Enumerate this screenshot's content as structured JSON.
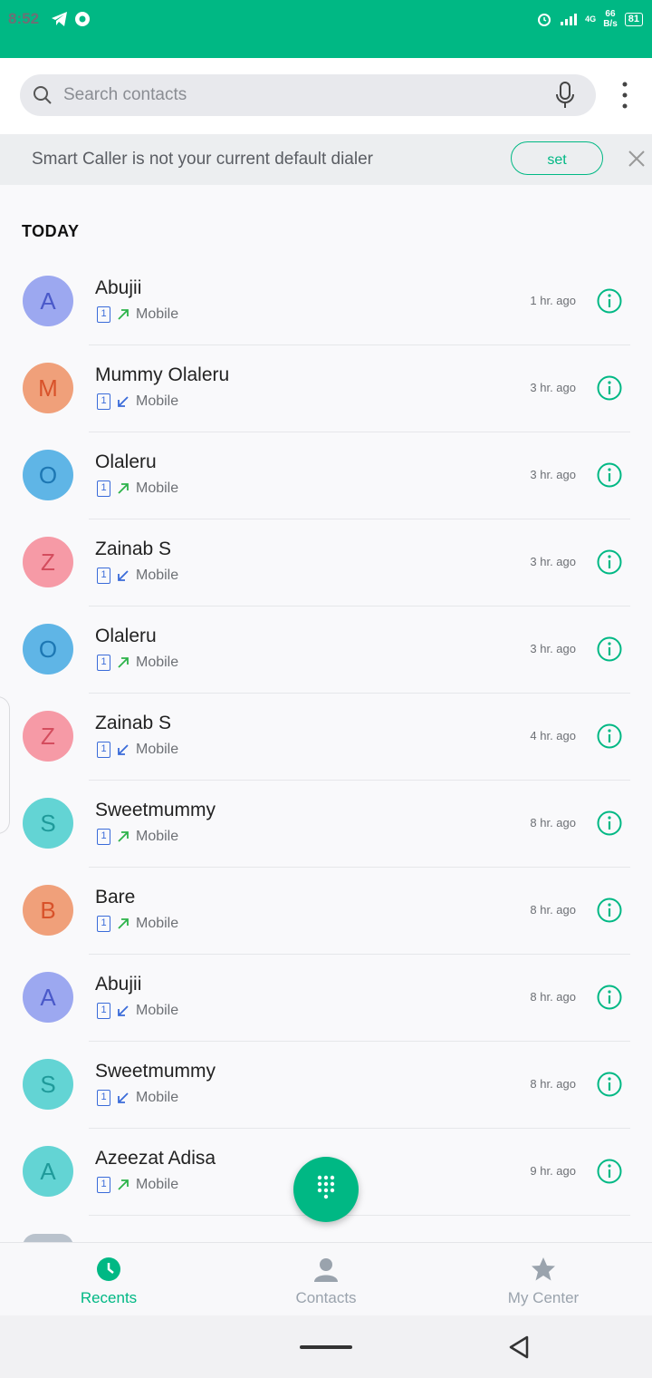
{
  "status": {
    "time": "8:52",
    "net_speed_top": "66",
    "net_speed_bottom": "B/s",
    "battery": "81",
    "network": "4G"
  },
  "search": {
    "placeholder": "Search contacts"
  },
  "banner": {
    "text": "Smart Caller is not your current default dialer",
    "button": "set"
  },
  "section": {
    "title": "TODAY"
  },
  "calls": [
    {
      "initial": "A",
      "name": "Abujii",
      "type": "outgoing",
      "label": "Mobile",
      "sim": "1",
      "time": "1 hr. ago",
      "bg": "#9ca8f0",
      "fg": "#4a59c9"
    },
    {
      "initial": "M",
      "name": "Mummy Olaleru",
      "type": "incoming",
      "label": "Mobile",
      "sim": "1",
      "time": "3 hr. ago",
      "bg": "#f0a07a",
      "fg": "#d8522a"
    },
    {
      "initial": "O",
      "name": "Olaleru",
      "type": "outgoing",
      "label": "Mobile",
      "sim": "1",
      "time": "3 hr. ago",
      "bg": "#5fb5e6",
      "fg": "#1d77b3"
    },
    {
      "initial": "Z",
      "name": "Zainab S",
      "type": "incoming",
      "label": "Mobile",
      "sim": "1",
      "time": "3 hr. ago",
      "bg": "#f69aa6",
      "fg": "#d44d5e"
    },
    {
      "initial": "O",
      "name": "Olaleru",
      "type": "outgoing",
      "label": "Mobile",
      "sim": "1",
      "time": "3 hr. ago",
      "bg": "#5fb5e6",
      "fg": "#1d77b3"
    },
    {
      "initial": "Z",
      "name": "Zainab S",
      "type": "incoming",
      "label": "Mobile",
      "sim": "1",
      "time": "4 hr. ago",
      "bg": "#f69aa6",
      "fg": "#d44d5e"
    },
    {
      "initial": "S",
      "name": "Sweetmummy",
      "type": "outgoing",
      "label": "Mobile",
      "sim": "1",
      "time": "8 hr. ago",
      "bg": "#63d4d4",
      "fg": "#1f9a9a"
    },
    {
      "initial": "B",
      "name": "Bare",
      "type": "outgoing",
      "label": "Mobile",
      "sim": "1",
      "time": "8 hr. ago",
      "bg": "#f0a07a",
      "fg": "#d8522a"
    },
    {
      "initial": "A",
      "name": "Abujii",
      "type": "incoming",
      "label": "Mobile",
      "sim": "1",
      "time": "8 hr. ago",
      "bg": "#9ca8f0",
      "fg": "#4a59c9"
    },
    {
      "initial": "S",
      "name": "Sweetmummy",
      "type": "incoming",
      "label": "Mobile",
      "sim": "1",
      "time": "8 hr. ago",
      "bg": "#63d4d4",
      "fg": "#1f9a9a"
    },
    {
      "initial": "A",
      "name": "Azeezat Adisa",
      "type": "outgoing",
      "label": "Mobile",
      "sim": "1",
      "time": "9 hr. ago",
      "bg": "#63d4d4",
      "fg": "#1f9a9a"
    }
  ],
  "nav": {
    "tabs": [
      {
        "label": "Recents",
        "icon": "clock-icon"
      },
      {
        "label": "Contacts",
        "icon": "person-icon"
      },
      {
        "label": "My Center",
        "icon": "star-icon"
      }
    ],
    "active": "Recents"
  },
  "colors": {
    "accent": "#00b884",
    "outgoing_arrow": "#2db34a",
    "incoming_arrow": "#3a6bd9"
  }
}
